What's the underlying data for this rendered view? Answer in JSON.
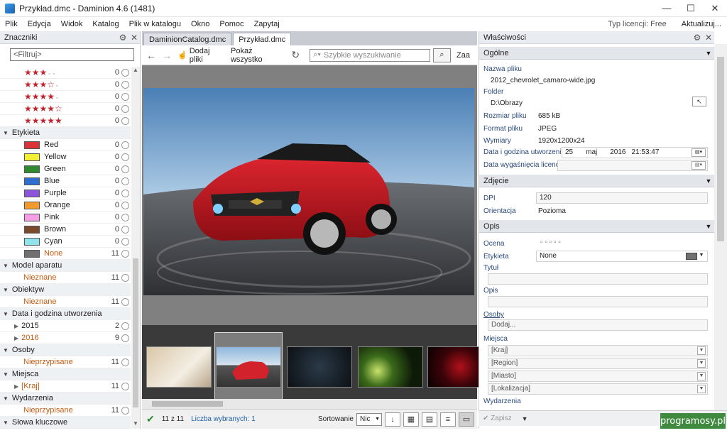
{
  "window": {
    "title": "Przykład.dmc - Daminion 4.6 (1481)",
    "min": "—",
    "max": "☐",
    "close": "✕"
  },
  "menu": [
    "Plik",
    "Edycja",
    "Widok",
    "Katalog",
    "Plik w katalogu",
    "Okno",
    "Pomoc",
    "Zapytaj"
  ],
  "license": "Typ licencji: Free",
  "update": "Aktualizuj...",
  "left": {
    "title": "Znaczniki",
    "filter_placeholder": "<Filtruj>",
    "stars": [
      {
        "full": "★★★",
        "empty": 2,
        "count": "0"
      },
      {
        "full": "★★★☆",
        "empty": 1,
        "count": "0"
      },
      {
        "full": "★★★★",
        "empty": 1,
        "count": "0"
      },
      {
        "full": "★★★★☆",
        "empty": 0,
        "count": "0"
      },
      {
        "full": "★★★★★",
        "empty": 0,
        "count": "0"
      }
    ],
    "etykieta": "Etykieta",
    "labels": [
      {
        "name": "Red",
        "color": "#d9343a",
        "count": "0"
      },
      {
        "name": "Yellow",
        "color": "#f3ef35",
        "count": "0"
      },
      {
        "name": "Green",
        "color": "#2f8a2f",
        "count": "0"
      },
      {
        "name": "Blue",
        "color": "#2f6fd0",
        "count": "0"
      },
      {
        "name": "Purple",
        "color": "#8a55d8",
        "count": "0"
      },
      {
        "name": "Orange",
        "color": "#f29a2e",
        "count": "0"
      },
      {
        "name": "Pink",
        "color": "#f59ee6",
        "count": "0"
      },
      {
        "name": "Brown",
        "color": "#7a4a2e",
        "count": "0"
      },
      {
        "name": "Cyan",
        "color": "#8fe3ea",
        "count": "0"
      },
      {
        "name": "None",
        "color": "#707070",
        "count": "11"
      }
    ],
    "model": "Model aparatu",
    "model_val": "Nieznane",
    "model_cnt": "11",
    "obiektyw": "Obiektyw",
    "obiektyw_val": "Nieznane",
    "obiektyw_cnt": "11",
    "data": "Data i godzina utworzenia",
    "y2015": "2015",
    "y2015_cnt": "2",
    "y2016": "2016",
    "y2016_cnt": "9",
    "osoby": "Osoby",
    "osoby_val": "Nieprzypisane",
    "osoby_cnt": "11",
    "miejsca": "Miejsca",
    "miejsca_val": "[Kraj]",
    "miejsca_cnt": "11",
    "wydarzenia": "Wydarzenia",
    "wydarzenia_val": "Nieprzypisane",
    "wydarzenia_cnt": "11",
    "slowa": "Słowa kluczowe"
  },
  "center": {
    "tabs": [
      "DaminionCatalog.dmc",
      "Przykład.dmc"
    ],
    "add": "Dodaj pliki",
    "show_all": "Pokaż wszystko",
    "search_placeholder": "Szybkie wyszukiwanie",
    "cut": "Zaa",
    "status_count": "11 z 11",
    "selected": "Liczba wybranych: 1",
    "sort_label": "Sortowanie",
    "sort_value": "Nic"
  },
  "right": {
    "title": "Właściwości",
    "ogolne": "Ogólne",
    "file_name_l": "Nazwa pliku",
    "file_name": "2012_chevrolet_camaro-wide.jpg",
    "folder_l": "Folder",
    "folder": "D:\\Obrazy",
    "size_l": "Rozmiar pliku",
    "size": "685 kB",
    "format_l": "Format pliku",
    "format": "JPEG",
    "dims_l": "Wymiary",
    "dims": "1920x1200x24",
    "created_l": "Data i godzina utworzenia",
    "day": "25",
    "month": "maj",
    "year": "2016",
    "time": "21:53:47",
    "expire_l": "Data wygaśnięcia licencji",
    "zdjecie": "Zdjęcie",
    "dpi_l": "DPI",
    "dpi": "120",
    "orient_l": "Orientacja",
    "orient": "Pozioma",
    "opis_sect": "Opis",
    "ocena_l": "Ocena",
    "ocena": "▫  ▫  ▫  ▫  ▫",
    "etykieta_l": "Etykieta",
    "etykieta": "None",
    "tytul_l": "Tytuł",
    "opis_l": "Opis",
    "osoby_l": "Osoby",
    "osoby_ph": "Dodaj...",
    "miejsca_l": "Miejsca",
    "kraj": "[Kraj]",
    "region": "[Region]",
    "miasto": "[Miasto]",
    "lokalizacja": "[Lokalizacja]",
    "wydarzenia_l": "Wydarzenia",
    "save": "Zapisz"
  },
  "watermark": "programosy.pl"
}
